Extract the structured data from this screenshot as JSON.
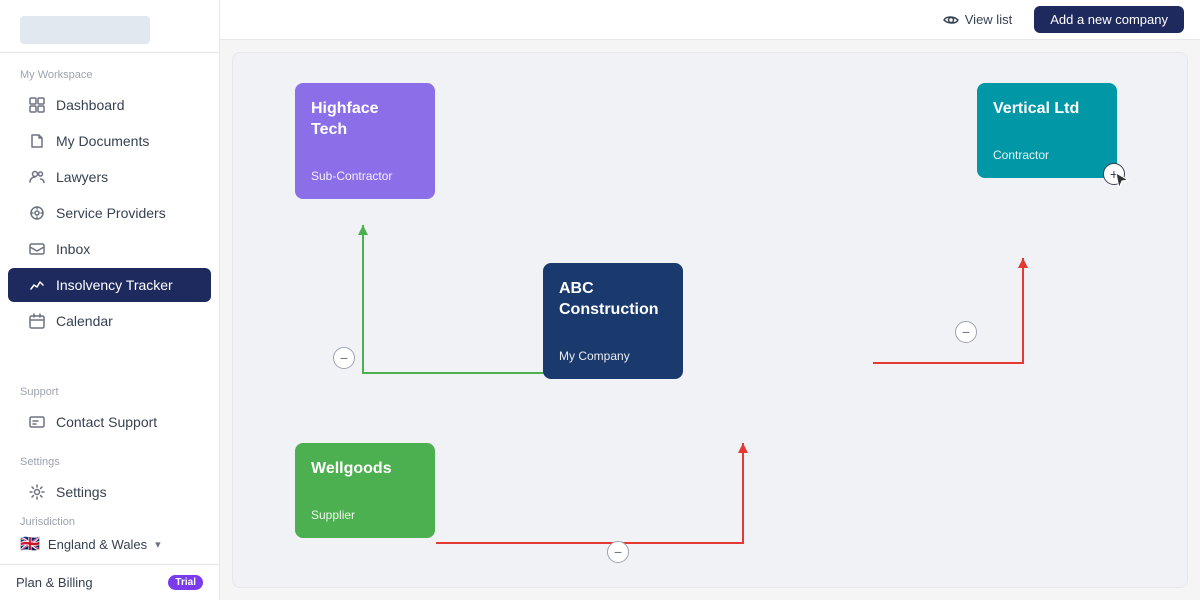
{
  "sidebar": {
    "workspace_label": "My Workspace",
    "items": [
      {
        "id": "dashboard",
        "label": "Dashboard",
        "icon": "⊞",
        "active": false
      },
      {
        "id": "my-documents",
        "label": "My Documents",
        "icon": "📄",
        "active": false
      },
      {
        "id": "lawyers",
        "label": "Lawyers",
        "icon": "👥",
        "active": false
      },
      {
        "id": "service-providers",
        "label": "Service Providers",
        "icon": "⚙",
        "active": false
      },
      {
        "id": "inbox",
        "label": "Inbox",
        "icon": "💬",
        "active": false
      },
      {
        "id": "insolvency-tracker",
        "label": "Insolvency Tracker",
        "icon": "📊",
        "active": true
      },
      {
        "id": "calendar",
        "label": "Calendar",
        "icon": "📅",
        "active": false
      }
    ],
    "support_label": "Support",
    "support_items": [
      {
        "id": "contact-support",
        "label": "Contact Support",
        "icon": "💬"
      }
    ],
    "settings_label": "Settings",
    "settings_items": [
      {
        "id": "settings",
        "label": "Settings",
        "icon": "⚙"
      }
    ],
    "jurisdiction_label": "Jurisdiction",
    "jurisdiction": {
      "flag": "🇬🇧",
      "label": "England & Wales",
      "chevron": "▾"
    },
    "plan_label": "Plan & Billing",
    "trial_badge": "Trial"
  },
  "topbar": {
    "view_list_label": "View list",
    "add_company_label": "Add a new company"
  },
  "canvas": {
    "cards": [
      {
        "id": "highface-tech",
        "title": "Highface Tech",
        "subtitle": "Sub-Contractor",
        "color": "#8b6fe8"
      },
      {
        "id": "vertical-ltd",
        "title": "Vertical Ltd",
        "subtitle": "Contractor",
        "color": "#0097a7"
      },
      {
        "id": "abc-construction",
        "title": "ABC Construction",
        "subtitle": "My Company",
        "color": "#1a3a6e"
      },
      {
        "id": "wellgoods",
        "title": "Wellgoods",
        "subtitle": "Supplier",
        "color": "#4caf50"
      }
    ],
    "controls": {
      "plus_label": "+",
      "minus_label": "−"
    }
  }
}
